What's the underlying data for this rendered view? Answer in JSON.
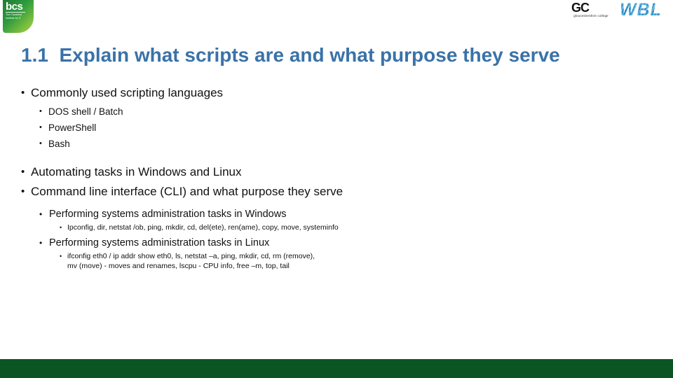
{
  "header": {
    "bcs_logo": {
      "name": "bcs-logo",
      "wordmark": "bcs",
      "tagline": "The Chartered Institute for IT",
      "color": "#2e9c3e"
    },
    "gc_logo": {
      "name": "gc-logo",
      "mark": "GC",
      "subtitle": "gloucestershire college",
      "color": "#111111"
    },
    "wbl_logo": {
      "name": "wbl-logo",
      "text": "WBL",
      "color": "#0f86c9"
    }
  },
  "title": {
    "text": "1.1  Explain what scripts are and what purpose they serve",
    "color": "#3a72a8"
  },
  "bullet_glyph": "•",
  "content": {
    "section_languages": {
      "heading": "Commonly used scripting languages",
      "items": [
        "DOS shell / Batch",
        "PowerShell",
        "Bash"
      ]
    },
    "section_automating": {
      "heading": "Automating tasks in Windows and Linux"
    },
    "section_cli": {
      "heading": "Command line interface (CLI) and what purpose they serve",
      "windows": {
        "heading": "Performing systems administration tasks in Windows",
        "commands": "Ipconfig, dir, netstat /ob, ping, mkdir, cd, del(ete), ren(ame), copy, move,  systeminfo"
      },
      "linux": {
        "heading": "Performing systems administration tasks in Linux",
        "commands_line1": "ifconfig eth0 / ip addr show eth0, ls, netstat –a, ping, mkdir, cd, rm (remove),",
        "commands_line2": "mv (move) - moves and renames, lscpu - CPU info, free –m, top, tail"
      }
    }
  },
  "footer": {
    "bar_color": "#0a5522"
  }
}
